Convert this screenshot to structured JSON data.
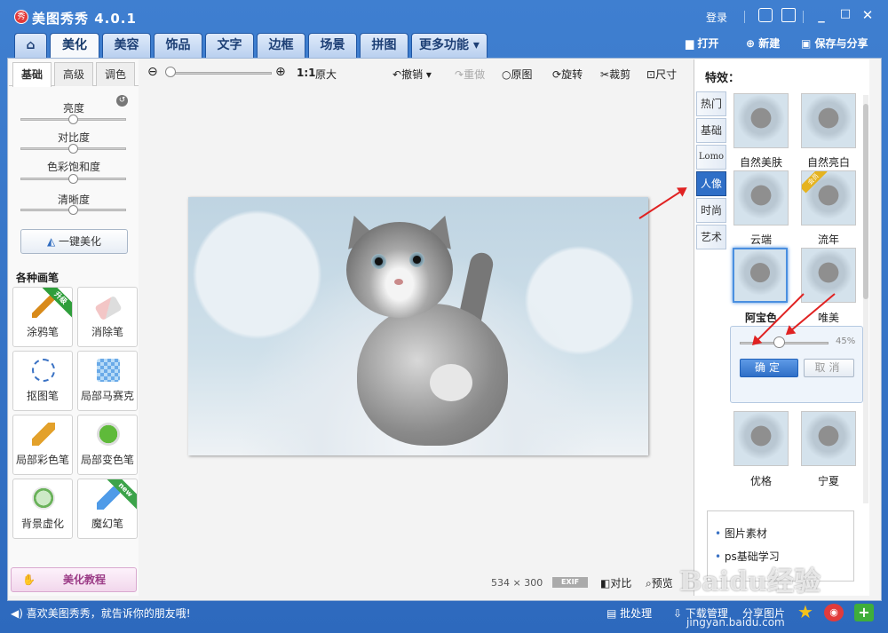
{
  "window": {
    "title": "美图秀秀 4.0.1",
    "login": "登录"
  },
  "main_tabs": [
    "美化",
    "美容",
    "饰品",
    "文字",
    "边框",
    "场景",
    "拼图",
    "更多功能"
  ],
  "top_right": {
    "open": "打开",
    "new": "新建",
    "save": "保存与分享"
  },
  "left": {
    "subtabs": [
      "基础",
      "高级",
      "调色"
    ],
    "sliders": [
      "亮度",
      "对比度",
      "色彩饱和度",
      "清晰度"
    ],
    "one_key": "一键美化",
    "pens_title": "各种画笔",
    "pens": [
      "涂鸦笔",
      "消除笔",
      "抠图笔",
      "局部马赛克",
      "局部彩色笔",
      "局部变色笔",
      "背景虚化",
      "魔幻笔"
    ],
    "ribbons": {
      "upgrade": "升级",
      "new": "new"
    },
    "tutorial": "美化教程"
  },
  "toolbar": {
    "zoom_ratio": "1:1",
    "original_size": "原大",
    "undo": "撤销",
    "redo": "重做",
    "original": "原图",
    "rotate": "旋转",
    "crop": "裁剪",
    "size": "尺寸"
  },
  "canvas_footer": {
    "width": "534",
    "times": "×",
    "height": "300",
    "exif": "EXIF",
    "compare": "对比",
    "preview": "预览"
  },
  "right": {
    "title": "特效：",
    "vtabs": [
      "热门",
      "基础",
      "Lomo",
      "人像",
      "时尚",
      "艺术"
    ],
    "effects": [
      "自然美肤",
      "自然亮白",
      "云端",
      "流年",
      "阿宝色",
      "唯美",
      "优格",
      "宁夏"
    ],
    "vip_badge": "会员",
    "adjust": {
      "percent": "45%",
      "ok": "确定",
      "cancel": "取消"
    },
    "ads": [
      "图片素材",
      "ps基础学习"
    ]
  },
  "status": {
    "message": "喜欢美图秀秀，就告诉你的朋友哦!",
    "batch": "批处理",
    "download": "下载管理",
    "share": "分享图片"
  },
  "watermark": {
    "logo": "Baidu经验",
    "url": "jingyan.baidu.com"
  },
  "colors": {
    "titlebar": "#3f7fd0",
    "accent": "#2f6fc7",
    "arrow": "#e02222"
  }
}
